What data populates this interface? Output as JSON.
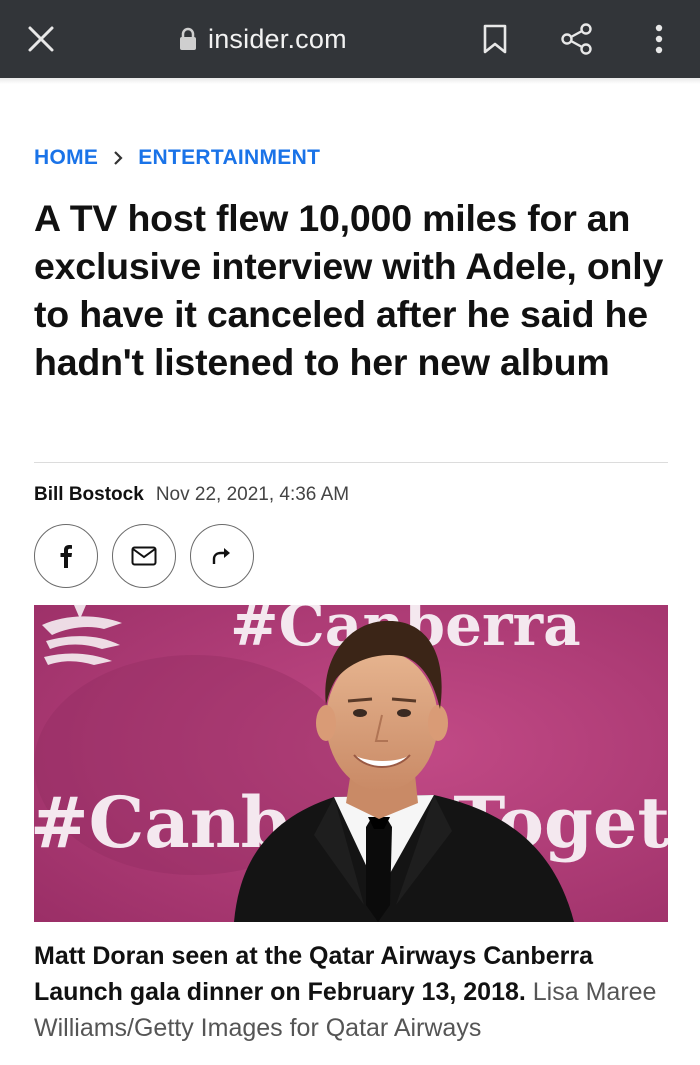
{
  "browser": {
    "url": "insider.com",
    "icons": {
      "close": "close-icon",
      "lock": "lock-icon",
      "bookmark": "bookmark-icon",
      "share": "share-icon",
      "menu": "more-vert-icon"
    }
  },
  "breadcrumb": {
    "home": "HOME",
    "separator": ">",
    "section": "ENTERTAINMENT"
  },
  "article": {
    "headline": "A TV host flew 10,000 miles for an exclusive interview with Adele, only to have it canceled after he said he hadn't listened to her new album",
    "author": "Bill Bostock",
    "date": "Nov 22, 2021, 4:36 AM"
  },
  "share": {
    "facebook_icon": "facebook-icon",
    "email_icon": "mail-icon",
    "share_icon": "share-arrow-icon"
  },
  "hero": {
    "backdrop_text_top": "#Canberra",
    "backdrop_text_bottom": "#CanberraTogether"
  },
  "caption": {
    "text": "Matt Doran seen at the Qatar Airways Canberra Launch gala dinner on February 13, 2018.",
    "credit": "Lisa Maree Williams/Getty Images for Qatar Airways"
  },
  "colors": {
    "topbar": "#323539",
    "link": "#1a73e8",
    "backdrop": "#a63a72"
  }
}
